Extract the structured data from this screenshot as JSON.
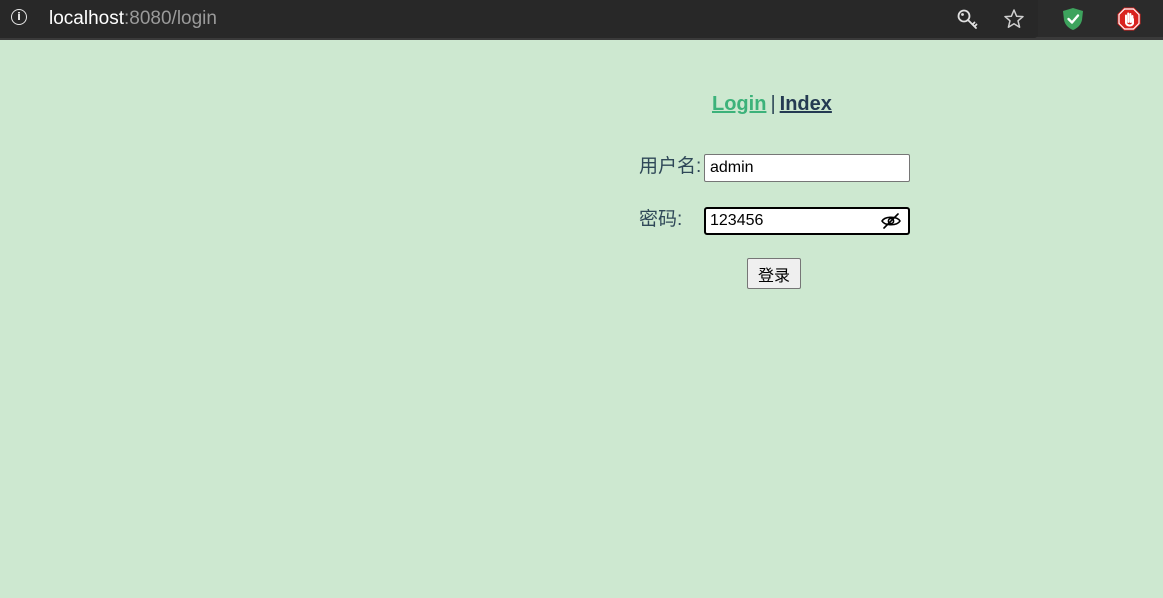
{
  "browser": {
    "url_host": "localhost",
    "url_path": ":8080/login",
    "icons": {
      "info": "info-icon",
      "key": "key-icon",
      "star": "star-icon",
      "extension_1": "shield-check-icon",
      "extension_2": "stop-hand-icon"
    }
  },
  "nav": {
    "login_label": "Login",
    "separator": "|",
    "index_label": "Index"
  },
  "form": {
    "username_label": "用户名:",
    "username_value": "admin",
    "password_label": "密码:",
    "password_value": "123456",
    "password_toggle_icon": "eye-slash-icon",
    "submit_label": "登录"
  },
  "colors": {
    "page_background": "#cde8d0",
    "login_link": "#3cb27a",
    "index_link": "#243a52",
    "browser_bar": "#2b2b2b"
  }
}
